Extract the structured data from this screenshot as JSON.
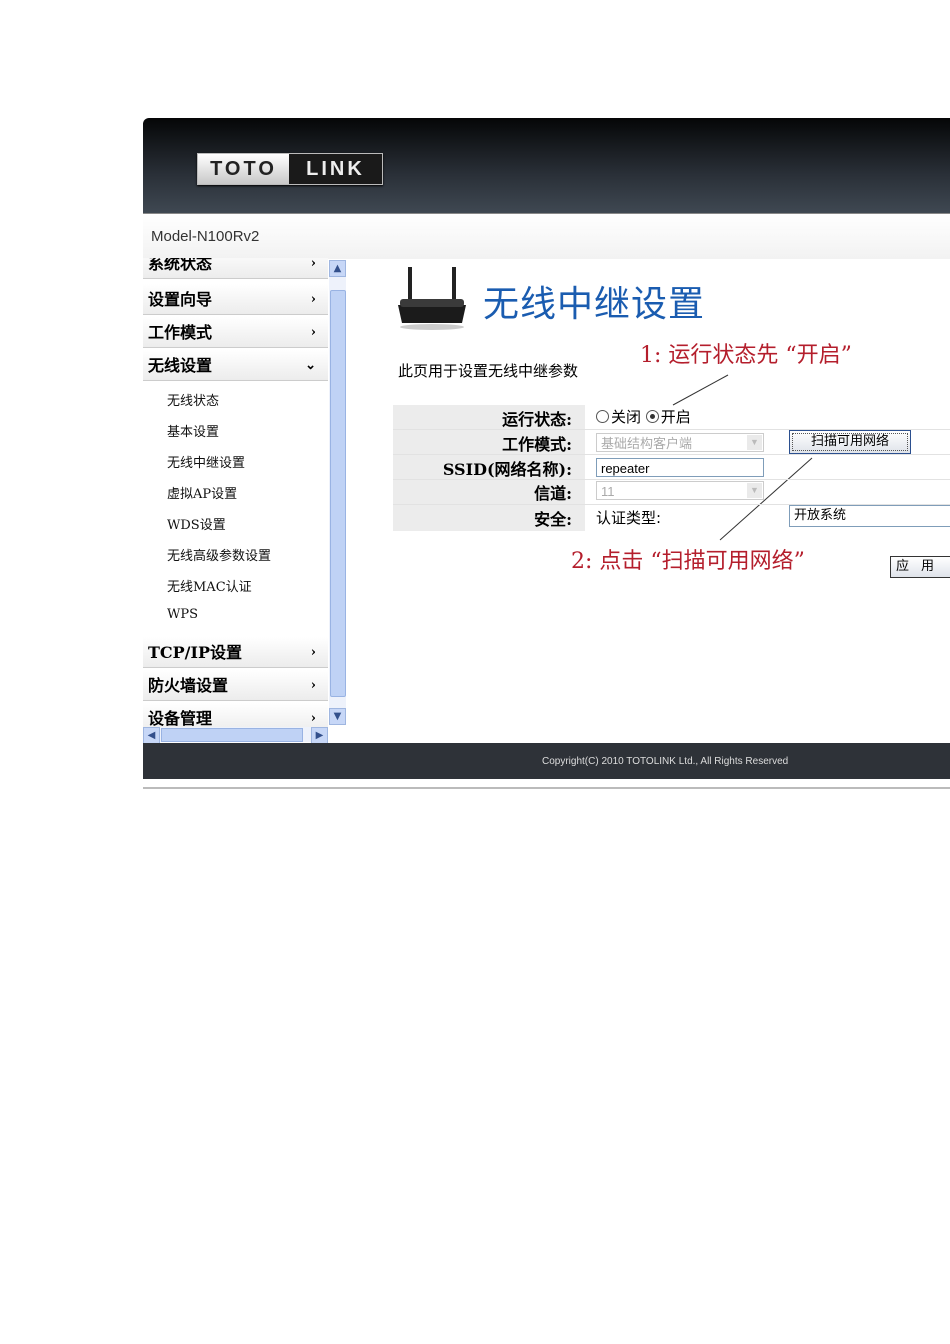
{
  "header": {
    "logo_left": "TOTO",
    "logo_right": "LINK",
    "model": "Model-N100Rv2"
  },
  "sidebar": {
    "items": [
      {
        "label": "系统状态",
        "chevron": "›"
      },
      {
        "label": "设置向导",
        "chevron": "›"
      },
      {
        "label": "工作模式",
        "chevron": "›"
      },
      {
        "label": "无线设置",
        "chevron": "⌄"
      },
      {
        "label": "TCP/IP设置",
        "chevron": "›"
      },
      {
        "label": "防火墙设置",
        "chevron": "›"
      },
      {
        "label": "设备管理",
        "chevron": "›"
      }
    ],
    "subitems": [
      "无线状态",
      "基本设置",
      "无线中继设置",
      "虚拟AP设置",
      "WDS设置",
      "无线高级参数设置",
      "无线MAC认证",
      "WPS"
    ]
  },
  "main": {
    "title": "无线中继设置",
    "description": "此页用于设置无线中继参数",
    "annotation1": "1: 运行状态先 “开启”",
    "annotation2": "2: 点击 “扫描可用网络”",
    "form": {
      "status_label": "运行状态:",
      "status_off": "关闭",
      "status_on": "开启",
      "status_selected": "开启",
      "mode_label": "工作模式:",
      "mode_value": "基础结构客户端",
      "scan_button": "扫描可用网络",
      "ssid_label": "SSID(网络名称):",
      "ssid_value": "repeater",
      "channel_label": "信道:",
      "channel_value": "11",
      "security_label": "安全:",
      "auth_label": "认证类型:",
      "auth_value": "开放系统",
      "apply_button": "应用"
    }
  },
  "footer": {
    "copyright": "Copyright(C) 2010 TOTOLINK Ltd.,   All Rights Reserved"
  }
}
